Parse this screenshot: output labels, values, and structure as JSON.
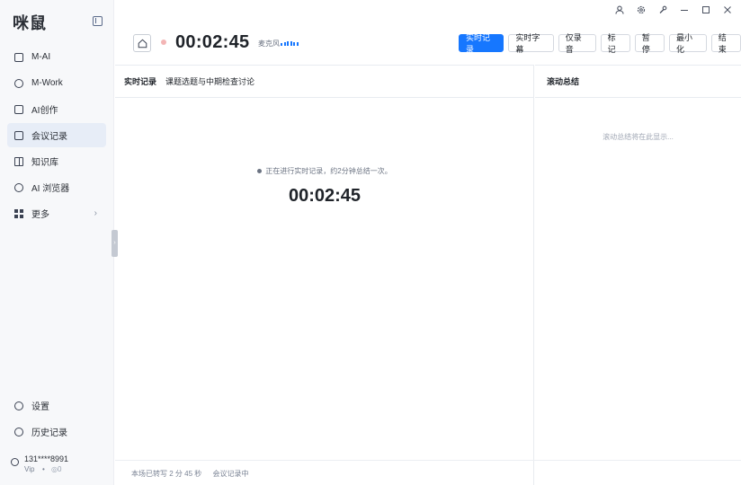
{
  "app": {
    "logo": "咪鼠"
  },
  "sidebar": {
    "items": [
      {
        "label": "M-AI",
        "icon": "monitor-icon"
      },
      {
        "label": "M-Work",
        "icon": "flame-icon"
      },
      {
        "label": "AI创作",
        "icon": "image-icon"
      },
      {
        "label": "会议记录",
        "icon": "edit-note-icon",
        "active": true
      },
      {
        "label": "知识库",
        "icon": "book-icon"
      },
      {
        "label": "AI 浏览器",
        "icon": "compass-icon"
      },
      {
        "label": "更多",
        "icon": "grid-icon",
        "has_chevron": true
      }
    ],
    "bottom": [
      {
        "label": "设置",
        "icon": "gear-icon"
      },
      {
        "label": "历史记录",
        "icon": "clock-icon"
      }
    ],
    "user": {
      "phone": "131****8991",
      "tier": "Vip",
      "separator": "•",
      "coins": "0"
    }
  },
  "toolbar": {
    "timer": "00:02:45",
    "mic_label": "麦克风",
    "buttons": [
      "实时记录",
      "实时字幕",
      "仅录音",
      "标记",
      "暂停",
      "最小化",
      "结束"
    ]
  },
  "left_panel": {
    "tab_active": "实时记录",
    "meeting_title": "课题选题与中期检查讨论",
    "status": "正在进行实时记录，约2分钟总结一次。",
    "timer": "00:02:45",
    "footer_transcribed": "本场已转写 2 分 45 秒",
    "footer_state": "会议记录中"
  },
  "right_panel": {
    "title": "滚动总结",
    "placeholder": "滚动总结将在此显示..."
  },
  "colors": {
    "primary": "#1677ff",
    "active_nav": "#e7edf7",
    "sidebar_bg": "#f7f8fa"
  }
}
